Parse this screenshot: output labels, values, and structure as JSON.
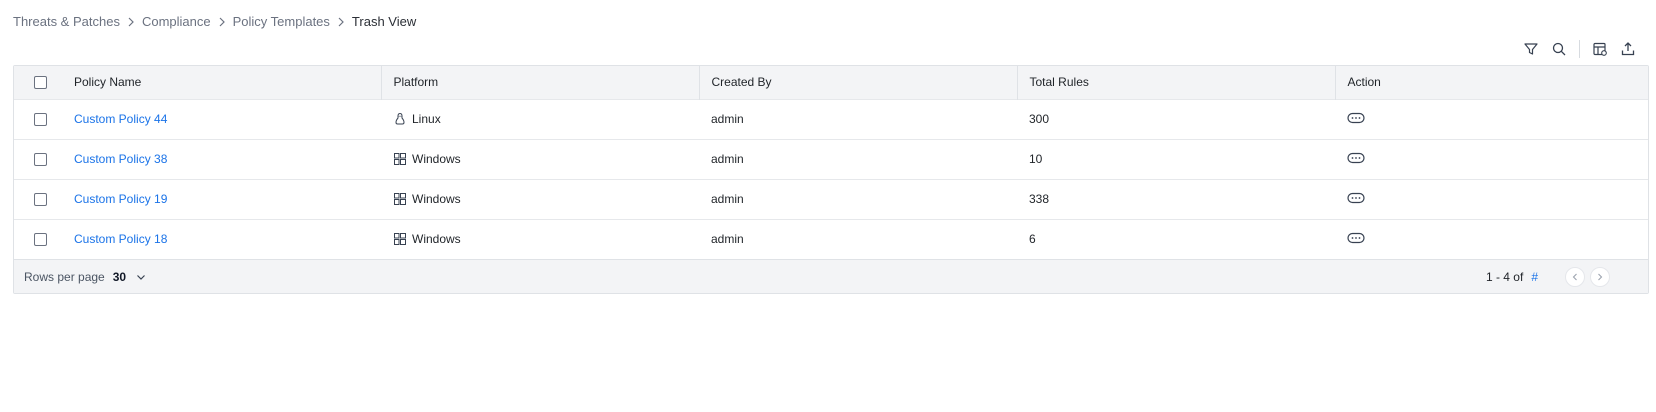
{
  "breadcrumb": {
    "items": [
      "Threats & Patches",
      "Compliance",
      "Policy Templates"
    ],
    "current": "Trash View"
  },
  "table": {
    "columns": [
      "Policy Name",
      "Platform",
      "Created By",
      "Total Rules",
      "Action"
    ],
    "rows": [
      {
        "name": "Custom Policy 44",
        "platform": "Linux",
        "platform_icon": "linux-icon",
        "created_by": "admin",
        "total_rules": "300"
      },
      {
        "name": "Custom Policy 38",
        "platform": "Windows",
        "platform_icon": "windows-icon",
        "created_by": "admin",
        "total_rules": "10"
      },
      {
        "name": "Custom Policy 19",
        "platform": "Windows",
        "platform_icon": "windows-icon",
        "created_by": "admin",
        "total_rules": "338"
      },
      {
        "name": "Custom Policy 18",
        "platform": "Windows",
        "platform_icon": "windows-icon",
        "created_by": "admin",
        "total_rules": "6"
      }
    ]
  },
  "footer": {
    "rows_per_page_label": "Rows per page",
    "rows_per_page_value": "30",
    "range": "1 - 4 of",
    "total": "#"
  },
  "toolbar_icons": [
    "filter-icon",
    "search-icon",
    "column-settings-icon",
    "export-icon"
  ],
  "colors": {
    "link": "#1a73e8",
    "header_bg": "#f3f4f6",
    "border": "#dfe2e6"
  }
}
